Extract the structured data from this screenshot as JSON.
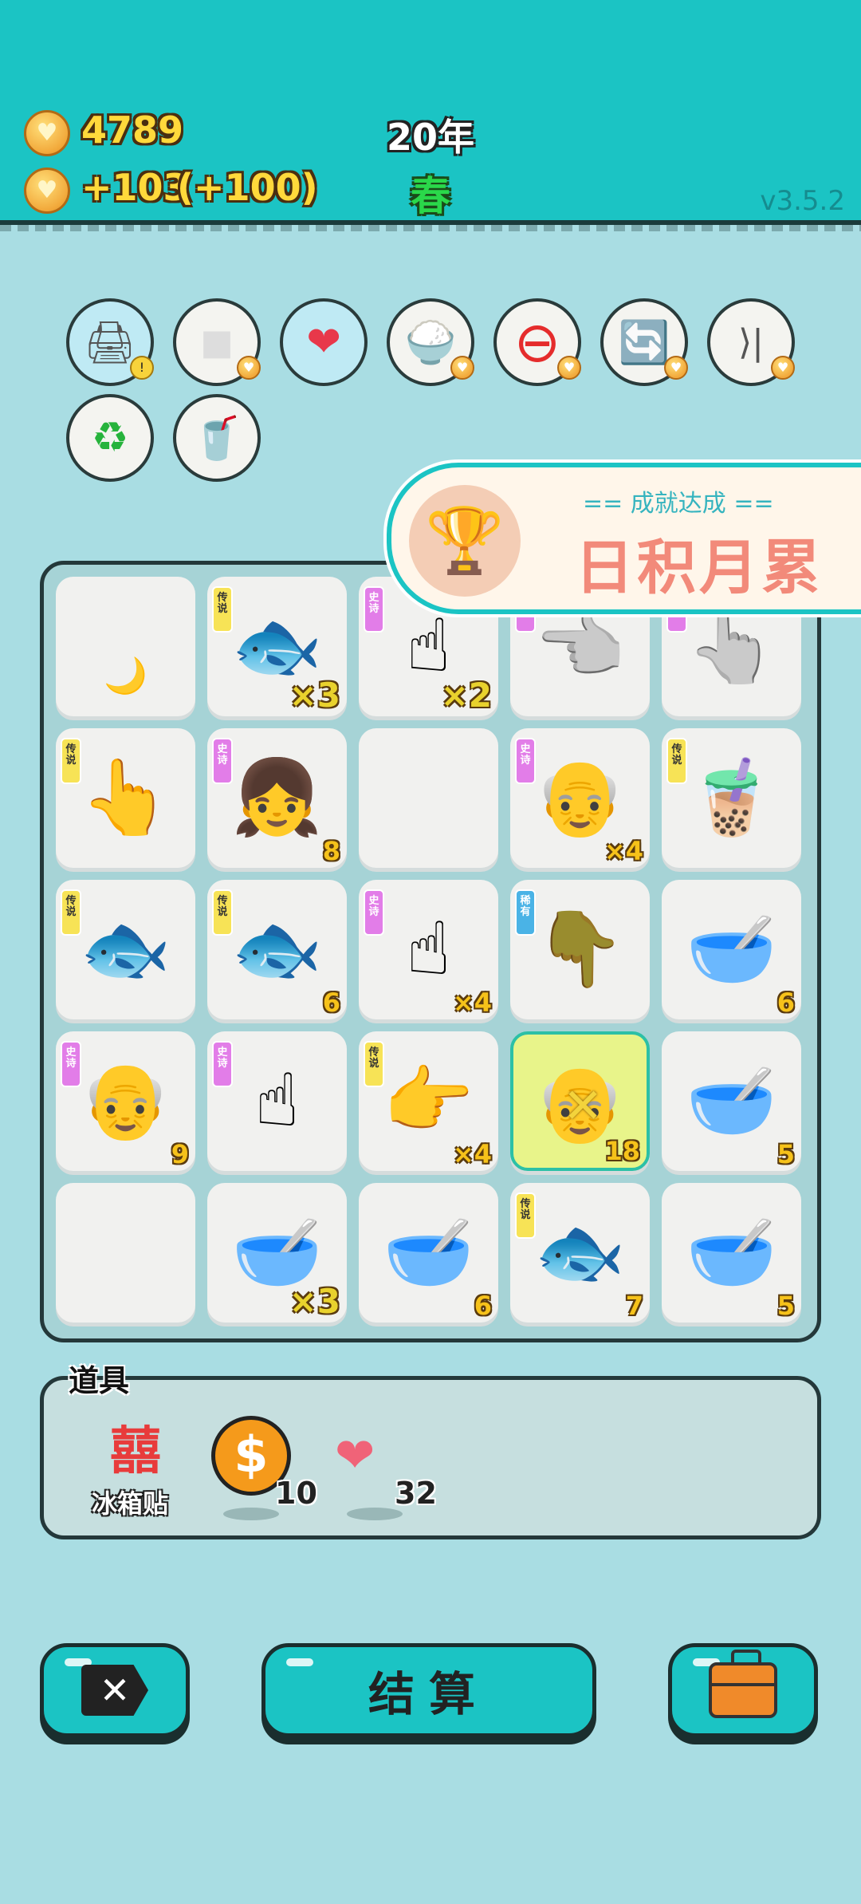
{
  "header": {
    "coins": "4789",
    "income": "+103",
    "income_bonus": "(+100)",
    "year": "20年",
    "season": "春",
    "version": "v3.5.2"
  },
  "tools": [
    {
      "icon": "printer-icon",
      "glyph": "🖨"
    },
    {
      "icon": "sugar-cubes-icon",
      "glyph": "◼"
    },
    {
      "icon": "heart-fan-icon",
      "glyph": "❤"
    },
    {
      "icon": "rice-bowl-icon",
      "glyph": "🍚"
    },
    {
      "icon": "minus-circle-icon",
      "glyph": "⊖"
    },
    {
      "icon": "refresh-icon",
      "glyph": "🔄"
    },
    {
      "icon": "skip-icon",
      "glyph": "⟩|"
    },
    {
      "icon": "recycle-bag-icon",
      "glyph": "♻"
    },
    {
      "icon": "bubble-tea-icon",
      "glyph": "🥤"
    }
  ],
  "achievement": {
    "subtitle": "== 成就达成 ==",
    "title": "日积月累"
  },
  "board": [
    {
      "tag": "",
      "item": "moon",
      "glyph": "🌙",
      "count": ""
    },
    {
      "tag": "传说",
      "item": "koi-fish",
      "glyph": "🐟",
      "count": "×3"
    },
    {
      "tag": "史诗",
      "item": "pointing-hand-gray",
      "glyph": "☝",
      "count": "×2"
    },
    {
      "tag": "史诗",
      "item": "pointing-hand-gray",
      "glyph": "👈",
      "count": ""
    },
    {
      "tag": "史诗",
      "item": "pointing-hand-gray",
      "glyph": "👆",
      "count": ""
    },
    {
      "tag": "传说",
      "item": "pointing-hand-gold",
      "glyph": "👆",
      "count": ""
    },
    {
      "tag": "史诗",
      "item": "girl-braids",
      "glyph": "👧",
      "count": "8"
    },
    {
      "tag": "",
      "item": "empty",
      "glyph": "",
      "count": ""
    },
    {
      "tag": "史诗",
      "item": "green-hat-man",
      "glyph": "👴",
      "count": "×4"
    },
    {
      "tag": "传说",
      "item": "bubble-tea",
      "glyph": "🧋",
      "count": ""
    },
    {
      "tag": "传说",
      "item": "koi-fish",
      "glyph": "🐟",
      "count": ""
    },
    {
      "tag": "传说",
      "item": "koi-fish",
      "glyph": "🐟",
      "count": "6"
    },
    {
      "tag": "史诗",
      "item": "pointing-hand-gray",
      "glyph": "☝",
      "count": "×4"
    },
    {
      "tag": "稀有",
      "item": "pointing-hand-brown",
      "glyph": "👇",
      "count": ""
    },
    {
      "tag": "",
      "item": "soup-bowl",
      "glyph": "🥣",
      "count": "6"
    },
    {
      "tag": "史诗",
      "item": "green-hat-man",
      "glyph": "👴",
      "count": "9"
    },
    {
      "tag": "史诗",
      "item": "pointing-hand-gray",
      "glyph": "☝",
      "count": ""
    },
    {
      "tag": "传说",
      "item": "pointing-hand-gold",
      "glyph": "👉",
      "count": "×4"
    },
    {
      "tag": "",
      "item": "green-hat-man-highlighted",
      "glyph": "👴",
      "count": "18"
    },
    {
      "tag": "",
      "item": "soup-bowl",
      "glyph": "🥣",
      "count": "5"
    },
    {
      "tag": "",
      "item": "empty",
      "glyph": "",
      "count": ""
    },
    {
      "tag": "",
      "item": "soup-bowl",
      "glyph": "🥣",
      "count": "×3"
    },
    {
      "tag": "",
      "item": "soup-bowl",
      "glyph": "🥣",
      "count": "6"
    },
    {
      "tag": "传说",
      "item": "koi-fish",
      "glyph": "🐟",
      "count": "7"
    },
    {
      "tag": "",
      "item": "soup-bowl",
      "glyph": "🥣",
      "count": "5"
    }
  ],
  "props": {
    "label": "道具",
    "fridge_magnet_glyph": "囍",
    "fridge_magnet_label": "冰箱贴",
    "coin_count": "10",
    "liver_count": "32"
  },
  "buttons": {
    "exit_glyph": "✕",
    "settle": "结算"
  }
}
